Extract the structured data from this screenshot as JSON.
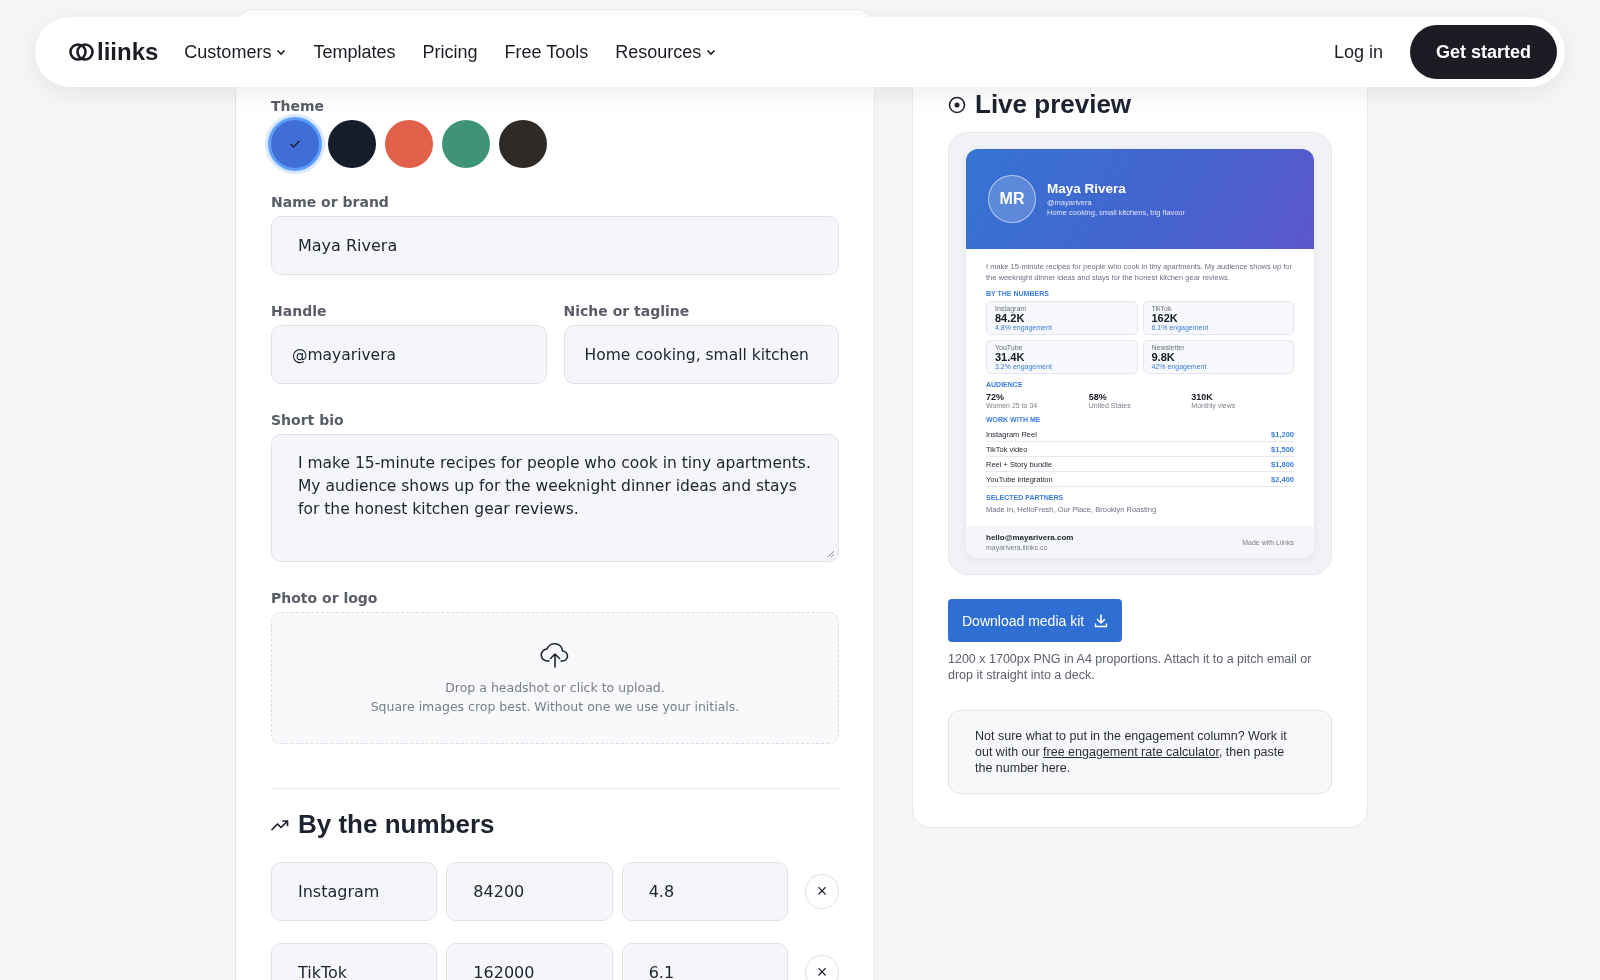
{
  "nav": {
    "logo": "liinks",
    "items": [
      {
        "label": "Customers",
        "dropdown": true
      },
      {
        "label": "Templates",
        "dropdown": false
      },
      {
        "label": "Pricing",
        "dropdown": false
      },
      {
        "label": "Free Tools",
        "dropdown": false
      },
      {
        "label": "Resources",
        "dropdown": true
      }
    ],
    "login": "Log in",
    "cta": "Get started"
  },
  "form": {
    "theme": {
      "label": "Theme",
      "swatches": [
        {
          "color": "#3f6fd6",
          "selected": true
        },
        {
          "color": "#161d2b",
          "selected": false
        },
        {
          "color": "#e0604a",
          "selected": false
        },
        {
          "color": "#3f9478",
          "selected": false
        },
        {
          "color": "#2e2a28",
          "selected": false
        }
      ]
    },
    "name": {
      "label": "Name or brand",
      "value": "Maya Rivera"
    },
    "handle": {
      "label": "Handle",
      "value": "@mayarivera"
    },
    "niche": {
      "label": "Niche or tagline",
      "value": "Home cooking, small kitchen"
    },
    "bio": {
      "label": "Short bio",
      "value": "I make 15-minute recipes for people who cook in tiny apartments. My audience shows up for the weeknight dinner ideas and stays for the honest kitchen gear reviews."
    },
    "photo": {
      "label": "Photo or logo",
      "line_1": "Drop a headshot or click to upload.",
      "line_2": "Square images crop best. Without one we use your initials."
    },
    "numbers": {
      "heading": "By the numbers",
      "rows": [
        {
          "platform": "Instagram",
          "followers": "84200",
          "engagement": "4.8",
          "remove": "×"
        },
        {
          "platform": "TikTok",
          "followers": "162000",
          "engagement": "6.1",
          "remove": "×"
        }
      ]
    }
  },
  "preview": {
    "heading": "Live preview",
    "card": {
      "initials": "MR",
      "name": "Maya Rivera",
      "handle": "@mayarivera",
      "tagline": "Home cooking, small kitchens, big flavour",
      "bio": "I make 15-minute recipes for people who cook in tiny apartments. My audience shows up for the weeknight dinner ideas and stays for the honest kitchen gear reviews.",
      "numbers_title": "BY THE NUMBERS",
      "stats": [
        {
          "platform": "Instagram",
          "value": "84.2K",
          "engagement": "4.8% engagement"
        },
        {
          "platform": "TikTok",
          "value": "162K",
          "engagement": "6.1% engagement"
        },
        {
          "platform": "YouTube",
          "value": "31.4K",
          "engagement": "3.2% engagement"
        },
        {
          "platform": "Newsletter",
          "value": "9.8K",
          "engagement": "42% engagement"
        }
      ],
      "audience_title": "AUDIENCE",
      "audience": [
        {
          "value": "72%",
          "label": "Women 25 to 34"
        },
        {
          "value": "58%",
          "label": "United States"
        },
        {
          "value": "310K",
          "label": "Monthly views"
        }
      ],
      "rates_title": "WORK WITH ME",
      "rates": [
        {
          "item": "Instagram Reel",
          "price": "$1,200"
        },
        {
          "item": "TikTok video",
          "price": "$1,500"
        },
        {
          "item": "Reel + Story bundle",
          "price": "$1,800"
        },
        {
          "item": "YouTube integration",
          "price": "$2,400"
        }
      ],
      "partners_title": "SELECTED PARTNERS",
      "partners": "Made In, HelloFresh, Our Place, Brooklyn Roasting",
      "email": "hello@mayarivera.com",
      "site": "mayarivera.liinks.co",
      "made_with": "Made with Liinks"
    },
    "download": "Download media kit",
    "caption": "1200 x 1700px PNG in A4 proportions. Attach it to a pitch email or drop it straight into a deck.",
    "note_before": "Not sure what to put in the engagement column? Work it out with our ",
    "note_link": "free engagement rate calculator",
    "note_after": ", then paste the number here."
  }
}
